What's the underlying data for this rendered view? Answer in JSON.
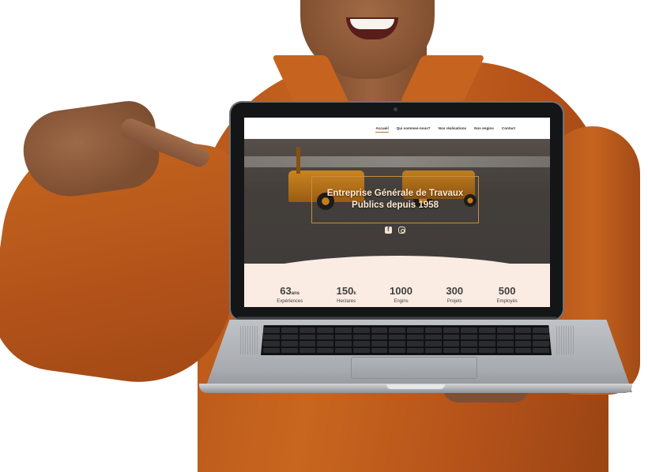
{
  "site": {
    "nav": {
      "items": [
        {
          "label": "Accueil",
          "active": true
        },
        {
          "label": "Qui sommes-nous?",
          "active": false
        },
        {
          "label": "Nos réalisations",
          "active": false
        },
        {
          "label": "Nos engins",
          "active": false
        },
        {
          "label": "Contact",
          "active": false
        }
      ]
    },
    "hero": {
      "title": "Entreprise Générale de Travaux Publics depuis 1958",
      "socials": [
        "facebook-icon",
        "instagram-icon"
      ]
    },
    "stats": [
      {
        "value": "63",
        "unit": "ans",
        "label": "Expériences"
      },
      {
        "value": "150",
        "unit": "k",
        "label": "Hectares"
      },
      {
        "value": "1000",
        "unit": "",
        "label": "Engins"
      },
      {
        "value": "300",
        "unit": "",
        "label": "Projets"
      },
      {
        "value": "500",
        "unit": "",
        "label": "Employés"
      }
    ]
  },
  "colors": {
    "accent": "#c0702a",
    "jacket": "#c6641f",
    "stats_background": "#fbece3"
  }
}
